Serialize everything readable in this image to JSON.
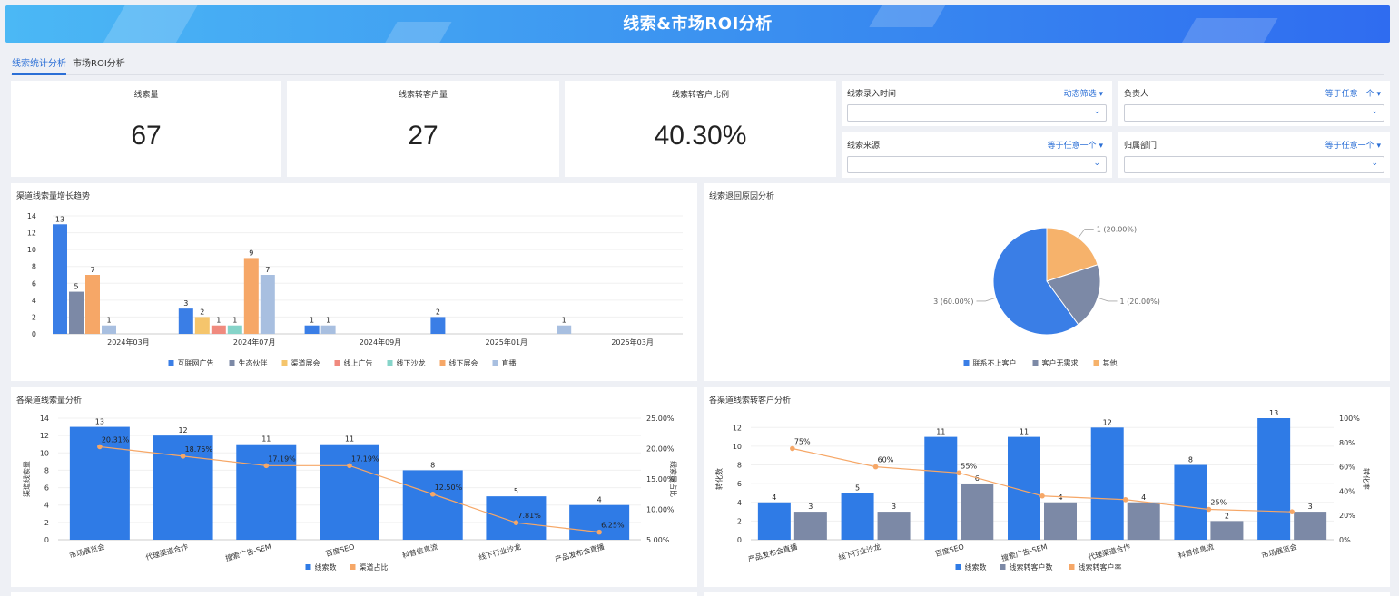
{
  "header": {
    "title": "线索&市场ROI分析"
  },
  "tabs": [
    {
      "label": "线索统计分析"
    },
    {
      "label": "市场ROI分析"
    }
  ],
  "kpis": [
    {
      "label": "线索量",
      "value": "67"
    },
    {
      "label": "线索转客户量",
      "value": "27"
    },
    {
      "label": "线索转客户比例",
      "value": "40.30%"
    }
  ],
  "filters": [
    {
      "label": "线索录入时间",
      "mode": "动态筛选"
    },
    {
      "label": "负责人",
      "mode": "等于任意一个"
    },
    {
      "label": "线索来源",
      "mode": "等于任意一个"
    },
    {
      "label": "归属部门",
      "mode": "等于任意一个"
    }
  ],
  "colors": {
    "blue": "#3a7ee6",
    "slate": "#7c89a6",
    "yellow": "#f5c56c",
    "red": "#f08a7e",
    "teal": "#86d4c9",
    "orange": "#f6a767",
    "lightblue": "#a8bfe0"
  },
  "chart_data": [
    {
      "title": "渠道线索量增长趋势",
      "type": "bar",
      "categories": [
        "2024年03月",
        "2024年07月",
        "2024年09月",
        "2025年01月",
        "2025年03月"
      ],
      "ylim": [
        0,
        14
      ],
      "yticks": [
        0,
        2,
        4,
        6,
        8,
        10,
        12,
        14
      ],
      "series": [
        {
          "name": "互联网广告",
          "color": "#3a7ee6",
          "values": [
            13,
            3,
            1,
            2,
            null
          ]
        },
        {
          "name": "生态伙伴",
          "color": "#7c89a6",
          "values": [
            5,
            null,
            null,
            null,
            null
          ]
        },
        {
          "name": "渠道展会",
          "color": "#f5c56c",
          "values": [
            null,
            2,
            null,
            null,
            null
          ]
        },
        {
          "name": "线上广告",
          "color": "#f08a7e",
          "values": [
            null,
            1,
            null,
            null,
            null
          ]
        },
        {
          "name": "线下沙龙",
          "color": "#86d4c9",
          "values": [
            null,
            1,
            null,
            null,
            null
          ]
        },
        {
          "name": "线下展会",
          "color": "#f6a767",
          "values": [
            7,
            9,
            null,
            null,
            null
          ]
        },
        {
          "name": "直播",
          "color": "#a8bfe0",
          "values": [
            1,
            7,
            1,
            null,
            1
          ]
        }
      ]
    },
    {
      "title": "线索退回原因分析",
      "type": "pie",
      "slices": [
        {
          "name": "联系不上客户",
          "value": 3,
          "label": "3 (60.00%)",
          "color": "#3a7ee6"
        },
        {
          "name": "客户无需求",
          "value": 1,
          "label": "1 (20.00%)",
          "color": "#7c89a6"
        },
        {
          "name": "其他",
          "value": 1,
          "label": "1 (20.00%)",
          "color": "#f6b26b"
        }
      ]
    },
    {
      "title": "各渠道线索量分析",
      "type": "bar",
      "categories": [
        "市场展览会",
        "代理渠道合作",
        "搜索广告-SEM",
        "百度SEO",
        "科普信息流",
        "线下行业沙龙",
        "产品发布会直播"
      ],
      "ylabel": "渠道线索量",
      "y2label": "线索量占比",
      "ylim": [
        0,
        14
      ],
      "yticks": [
        0,
        2,
        4,
        6,
        8,
        10,
        12,
        14
      ],
      "y2lim": [
        5,
        25
      ],
      "y2ticks": [
        "5.00%",
        "10.00%",
        "15.00%",
        "20.00%",
        "25.00%"
      ],
      "series": [
        {
          "name": "线索数",
          "type": "bar",
          "color": "#2f7be6",
          "values": [
            13,
            12,
            11,
            11,
            8,
            5,
            4
          ]
        },
        {
          "name": "渠道占比",
          "type": "line",
          "color": "#f6a767",
          "values": [
            20.31,
            18.75,
            17.19,
            17.19,
            12.5,
            7.81,
            6.25
          ],
          "labels": [
            "20.31%",
            "18.75%",
            "17.19%",
            "17.19%",
            "12.50%",
            "7.81%",
            "6.25%"
          ]
        }
      ]
    },
    {
      "title": "各渠道线索转客户分析",
      "type": "bar",
      "categories": [
        "产品发布会直播",
        "线下行业沙龙",
        "百度SEO",
        "搜索广告-SEM",
        "代理渠道合作",
        "科普信息流",
        "市场展览会"
      ],
      "ylabel": "转化数",
      "y2label": "转化率",
      "ylim": [
        0,
        13
      ],
      "yticks": [
        0,
        2,
        4,
        6,
        8,
        10,
        12
      ],
      "y2lim": [
        0,
        100
      ],
      "y2ticks": [
        "0%",
        "20%",
        "40%",
        "60%",
        "80%",
        "100%"
      ],
      "series": [
        {
          "name": "线索数",
          "type": "bar",
          "color": "#2f7be6",
          "values": [
            4,
            5,
            11,
            11,
            12,
            8,
            13
          ]
        },
        {
          "name": "线索转客户数",
          "type": "bar",
          "color": "#7c89a6",
          "values": [
            3,
            3,
            6,
            4,
            4,
            2,
            3
          ]
        },
        {
          "name": "线索转客户率",
          "type": "line",
          "color": "#f6a767",
          "values": [
            75,
            60,
            55,
            36,
            33,
            25,
            23
          ],
          "labels": [
            "75%",
            "60%",
            "55%",
            "",
            "",
            "25%",
            ""
          ]
        }
      ]
    }
  ]
}
